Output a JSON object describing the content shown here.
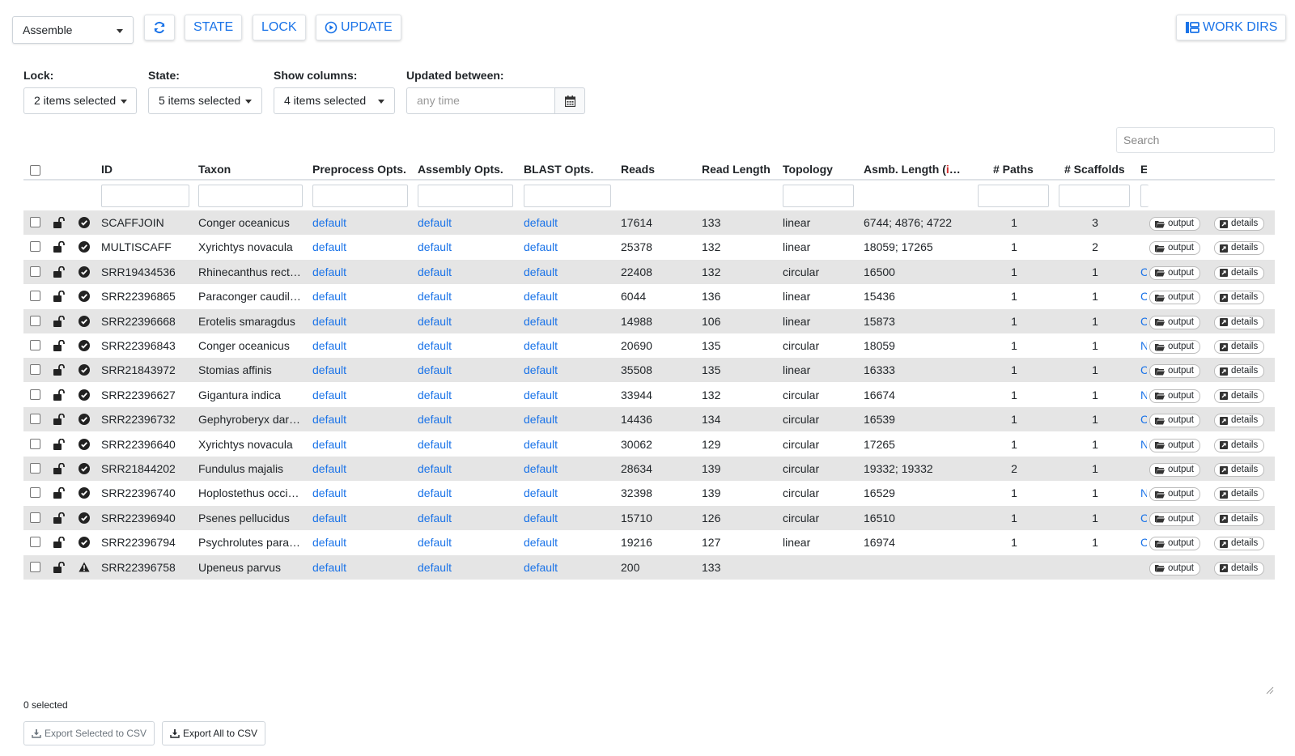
{
  "toolbar": {
    "mode_select": "Assemble",
    "state_label": "STATE",
    "lock_label": "LOCK",
    "update_label": "UPDATE",
    "workdirs_label": "WORK DIRS"
  },
  "filters": {
    "lock": {
      "label": "Lock:",
      "value": "2 items selected"
    },
    "state": {
      "label": "State:",
      "value": "5 items selected"
    },
    "columns": {
      "label": "Show columns:",
      "value": "4 items selected"
    },
    "updated": {
      "label": "Updated between:",
      "placeholder": "any time"
    }
  },
  "search": {
    "placeholder": "Search"
  },
  "table": {
    "headers": {
      "id": "ID",
      "taxon": "Taxon",
      "preprocess": "Preprocess Opts.",
      "assembly": "Assembly Opts.",
      "blast": "BLAST Opts.",
      "reads": "Reads",
      "read_length": "Read Length",
      "topology": "Topology",
      "asmb_length_prefix": "Asmb. Length (",
      "asmb_length_i": "i",
      "asmb_length_suffix": "…",
      "paths": "# Paths",
      "scaffolds": "# Scaffolds",
      "extra": "E"
    },
    "output_label": "output",
    "details_label": "details",
    "rows": [
      {
        "id": "SCAFFJOIN",
        "taxon": "Conger oceanicus",
        "pre": "default",
        "asm": "default",
        "blast": "default",
        "reads": "17614",
        "rlen": "133",
        "topo": "linear",
        "alen": "6744; 4876; 4722",
        "paths": "1",
        "scaf": "3",
        "extra": "",
        "status": "ok"
      },
      {
        "id": "MULTISCAFF",
        "taxon": "Xyrichtys novacula",
        "pre": "default",
        "asm": "default",
        "blast": "default",
        "reads": "25378",
        "rlen": "132",
        "topo": "linear",
        "alen": "18059; 17265",
        "paths": "1",
        "scaf": "2",
        "extra": "",
        "status": "ok"
      },
      {
        "id": "SRR19434536",
        "taxon": "Rhinecanthus rect…",
        "pre": "default",
        "asm": "default",
        "blast": "default",
        "reads": "22408",
        "rlen": "132",
        "topo": "circular",
        "alen": "16500",
        "paths": "1",
        "scaf": "1",
        "extra": "C",
        "status": "ok"
      },
      {
        "id": "SRR22396865",
        "taxon": "Paraconger caudil…",
        "pre": "default",
        "asm": "default",
        "blast": "default",
        "reads": "6044",
        "rlen": "136",
        "topo": "linear",
        "alen": "15436",
        "paths": "1",
        "scaf": "1",
        "extra": "C",
        "status": "ok"
      },
      {
        "id": "SRR22396668",
        "taxon": "Erotelis smaragdus",
        "pre": "default",
        "asm": "default",
        "blast": "default",
        "reads": "14988",
        "rlen": "106",
        "topo": "linear",
        "alen": "15873",
        "paths": "1",
        "scaf": "1",
        "extra": "C",
        "status": "ok"
      },
      {
        "id": "SRR22396843",
        "taxon": "Conger oceanicus",
        "pre": "default",
        "asm": "default",
        "blast": "default",
        "reads": "20690",
        "rlen": "135",
        "topo": "circular",
        "alen": "18059",
        "paths": "1",
        "scaf": "1",
        "extra": "N",
        "status": "ok"
      },
      {
        "id": "SRR21843972",
        "taxon": "Stomias affinis",
        "pre": "default",
        "asm": "default",
        "blast": "default",
        "reads": "35508",
        "rlen": "135",
        "topo": "linear",
        "alen": "16333",
        "paths": "1",
        "scaf": "1",
        "extra": "C",
        "status": "ok"
      },
      {
        "id": "SRR22396627",
        "taxon": "Gigantura indica",
        "pre": "default",
        "asm": "default",
        "blast": "default",
        "reads": "33944",
        "rlen": "132",
        "topo": "circular",
        "alen": "16674",
        "paths": "1",
        "scaf": "1",
        "extra": "N",
        "status": "ok"
      },
      {
        "id": "SRR22396732",
        "taxon": "Gephyroberyx dar…",
        "pre": "default",
        "asm": "default",
        "blast": "default",
        "reads": "14436",
        "rlen": "134",
        "topo": "circular",
        "alen": "16539",
        "paths": "1",
        "scaf": "1",
        "extra": "C",
        "status": "ok"
      },
      {
        "id": "SRR22396640",
        "taxon": "Xyrichtys novacula",
        "pre": "default",
        "asm": "default",
        "blast": "default",
        "reads": "30062",
        "rlen": "129",
        "topo": "circular",
        "alen": "17265",
        "paths": "1",
        "scaf": "1",
        "extra": "N",
        "status": "ok"
      },
      {
        "id": "SRR21844202",
        "taxon": "Fundulus majalis",
        "pre": "default",
        "asm": "default",
        "blast": "default",
        "reads": "28634",
        "rlen": "139",
        "topo": "circular",
        "alen": "19332; 19332",
        "paths": "2",
        "scaf": "1",
        "extra": "",
        "status": "ok"
      },
      {
        "id": "SRR22396740",
        "taxon": "Hoplostethus occi…",
        "pre": "default",
        "asm": "default",
        "blast": "default",
        "reads": "32398",
        "rlen": "139",
        "topo": "circular",
        "alen": "16529",
        "paths": "1",
        "scaf": "1",
        "extra": "N",
        "status": "ok"
      },
      {
        "id": "SRR22396940",
        "taxon": "Psenes pellucidus",
        "pre": "default",
        "asm": "default",
        "blast": "default",
        "reads": "15710",
        "rlen": "126",
        "topo": "circular",
        "alen": "16510",
        "paths": "1",
        "scaf": "1",
        "extra": "C",
        "status": "ok"
      },
      {
        "id": "SRR22396794",
        "taxon": "Psychrolutes para…",
        "pre": "default",
        "asm": "default",
        "blast": "default",
        "reads": "19216",
        "rlen": "127",
        "topo": "linear",
        "alen": "16974",
        "paths": "1",
        "scaf": "1",
        "extra": "C",
        "status": "ok"
      },
      {
        "id": "SRR22396758",
        "taxon": "Upeneus parvus",
        "pre": "default",
        "asm": "default",
        "blast": "default",
        "reads": "200",
        "rlen": "133",
        "topo": "",
        "alen": "",
        "paths": "",
        "scaf": "",
        "extra": "",
        "status": "warning"
      }
    ]
  },
  "footer": {
    "selected_count": "0 selected",
    "export_selected": "Export Selected to CSV",
    "export_all": "Export All to CSV"
  },
  "colors": {
    "accent": "#1a73e8",
    "row_stripe": "#e5e5e5",
    "asmb_i": "#d32f2f"
  }
}
